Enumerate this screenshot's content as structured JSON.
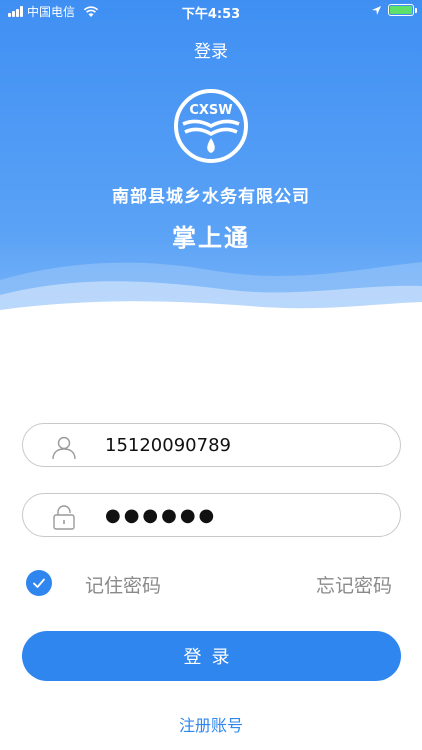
{
  "status_bar": {
    "carrier": "中国电信",
    "time": "下午4:53",
    "battery_color": "#5de16b"
  },
  "nav": {
    "title": "登录"
  },
  "logo": {
    "text": "CXSW",
    "icon": "water-drop-logo-icon"
  },
  "company_name": "南部县城乡水务有限公司",
  "app_name": "掌上通",
  "form": {
    "phone": {
      "value": "15120090789",
      "icon": "user-icon"
    },
    "password": {
      "value": "●●●●●●",
      "icon": "lock-icon"
    },
    "remember_label": "记住密码",
    "remember_checked": true,
    "forgot_label": "忘记密码",
    "login_label": "登录",
    "register_label": "注册账号"
  },
  "colors": {
    "primary": "#2f86ee",
    "header_top": "#3f8ff3",
    "muted_text": "#8a8a8a"
  }
}
